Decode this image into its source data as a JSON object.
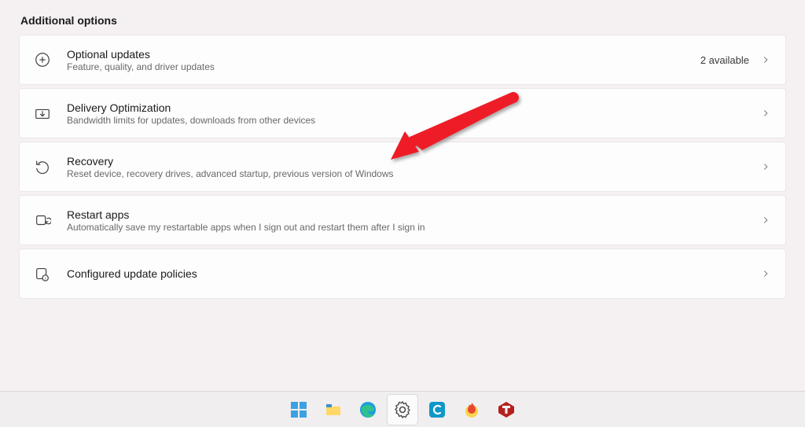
{
  "section_title": "Additional options",
  "options": [
    {
      "title": "Optional updates",
      "subtitle": "Feature, quality, and driver updates",
      "status": "2 available"
    },
    {
      "title": "Delivery Optimization",
      "subtitle": "Bandwidth limits for updates, downloads from other devices",
      "status": ""
    },
    {
      "title": "Recovery",
      "subtitle": "Reset device, recovery drives, advanced startup, previous version of Windows",
      "status": ""
    },
    {
      "title": "Restart apps",
      "subtitle": "Automatically save my restartable apps when I sign out and restart them after I sign in",
      "status": ""
    },
    {
      "title": "Configured update policies",
      "subtitle": "",
      "status": ""
    }
  ],
  "taskbar": {
    "items": [
      "start",
      "file-explorer",
      "edge",
      "settings",
      "cortana-c",
      "app-fire",
      "app-t"
    ]
  }
}
